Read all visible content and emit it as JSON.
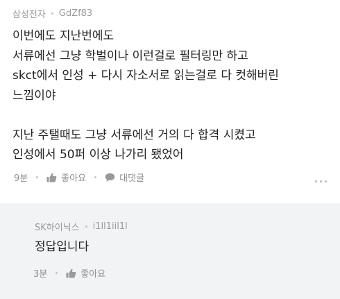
{
  "comment": {
    "company": "삼성전자",
    "nickname": "GdZf83",
    "lines": [
      "이번에도 지난번에도",
      "서류에선 그냥 학벌이나 이런걸로 필터링만 하고",
      "skct에서 인성 + 다시 자소서로 읽는걸로 다 컷해버린",
      "느낌이야",
      "",
      "지난 주탤때도 그냥 서류에선 거의 다 합격 시켰고",
      "인성에서 50퍼 이상 나가리 됐었어"
    ],
    "time": "9분",
    "like_label": "좋아요",
    "reply_label": "대댓글",
    "more_icon": "more-horizontal-icon"
  },
  "reply": {
    "company": "SK하이닉스",
    "nickname": "i1ll1iil1l",
    "text": "정답입니다",
    "time": "3분",
    "like_label": "좋아요"
  },
  "colors": {
    "text": "#222222",
    "meta": "#9a9a9a",
    "reply_background": "#f2f3f5"
  }
}
